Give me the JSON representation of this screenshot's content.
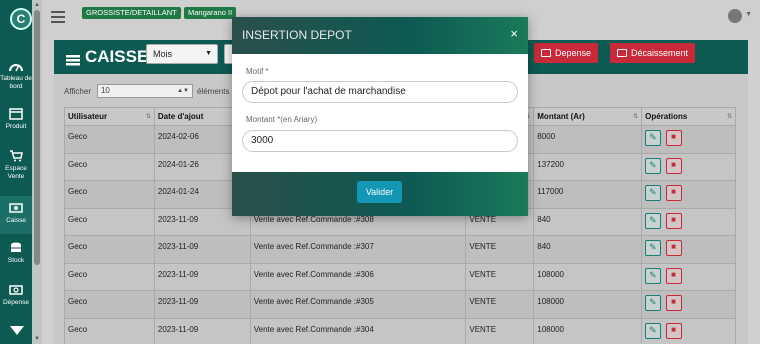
{
  "colors": {
    "brand": "#0d5a52",
    "danger": "#c92a3a",
    "primary": "#1497b5",
    "breadcrumb": "#1f7a45"
  },
  "breadcrumb": [
    "GROSSISTE/DETAILLANT",
    "Mangarano II"
  ],
  "breadcrumb_separator": ">",
  "sidebar": {
    "items": [
      {
        "label": "Tableau de bord",
        "icon": "dashboard-icon"
      },
      {
        "label": "Produit",
        "icon": "box-icon"
      },
      {
        "label": "Espace Vente",
        "icon": "cart-icon"
      },
      {
        "label": "Caisse",
        "icon": "cash-icon"
      },
      {
        "label": "Stock",
        "icon": "database-icon"
      },
      {
        "label": "Dépense",
        "icon": "money-icon"
      }
    ]
  },
  "header": {
    "title": "CAISSE",
    "period_value": "Mois",
    "buttons": {
      "depense": "Depense",
      "decaissement": "Décaissement"
    }
  },
  "list": {
    "show_label": "Afficher",
    "show_value": "10",
    "elements_label": "éléments"
  },
  "table": {
    "columns": [
      "Utilisateur",
      "Date d'ajout",
      "",
      "",
      "Montant (Ar)",
      "Opérations"
    ],
    "rows": [
      {
        "user": "Geco",
        "date": "2024-02-06",
        "desc": "",
        "type": "",
        "amount": "8000"
      },
      {
        "user": "Geco",
        "date": "2024-01-26",
        "desc": "",
        "type": "",
        "amount": "137200"
      },
      {
        "user": "Geco",
        "date": "2024-01-24",
        "desc": "",
        "type": "",
        "amount": "117000"
      },
      {
        "user": "Geco",
        "date": "2023-11-09",
        "desc": "Vente avec Ref.Commande :#308",
        "type": "VENTE",
        "amount": "840"
      },
      {
        "user": "Geco",
        "date": "2023-11-09",
        "desc": "Vente avec Ref.Commande :#307",
        "type": "VENTE",
        "amount": "840"
      },
      {
        "user": "Geco",
        "date": "2023-11-09",
        "desc": "Vente avec Ref.Commande :#306",
        "type": "VENTE",
        "amount": "108000"
      },
      {
        "user": "Geco",
        "date": "2023-11-09",
        "desc": "Vente avec Ref.Commande :#305",
        "type": "VENTE",
        "amount": "108000"
      },
      {
        "user": "Geco",
        "date": "2023-11-09",
        "desc": "Vente avec Ref.Commande :#304",
        "type": "VENTE",
        "amount": "108000"
      }
    ]
  },
  "modal": {
    "title": "INSERTION DEPOT",
    "close": "×",
    "motif_label": "Motif *",
    "motif_value": "Dépot pour l'achat de marchandise",
    "montant_label": "Montant *(en Ariary)",
    "montant_value": "3000",
    "submit": "Valider"
  }
}
